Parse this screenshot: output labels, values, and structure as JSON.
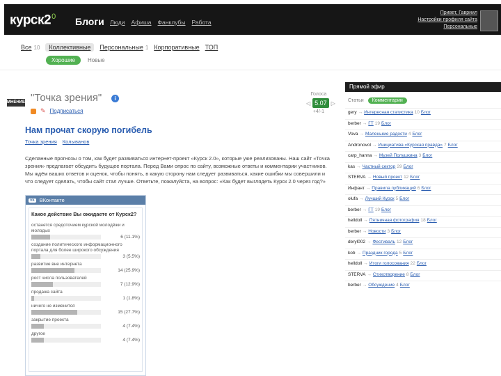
{
  "header": {
    "logo_text": "курск2",
    "logo_sup": "0",
    "section_title": "Блоги",
    "nav": [
      "Люди",
      "Афиша",
      "Фанклубы",
      "Работа"
    ],
    "user": {
      "line1": "Привет, Гавриил",
      "line2": "Настройки профиля сайта",
      "line3": "Персональные"
    }
  },
  "subnav": {
    "tabs": [
      {
        "label": "Все",
        "count": "10"
      },
      {
        "label": "Коллективные",
        "count": ""
      },
      {
        "label": "Персональные",
        "count": "1"
      },
      {
        "label": "Корпоративные",
        "count": ""
      },
      {
        "label": "ТОП",
        "count": ""
      }
    ],
    "pill_active": "Хорошие",
    "pill_other": "Новые"
  },
  "blog": {
    "logo_text": "МНЕНИЕ",
    "name": "\"Точка зрения\"",
    "info_icon": "i",
    "subscribe": "Подписаться"
  },
  "rating": {
    "label": "Голоса",
    "value": "5.07",
    "count": "+4/-1"
  },
  "post": {
    "title": "Нам прочат скорую погибель",
    "meta": [
      "Точка зрения",
      "Колыванов"
    ],
    "body": "Сделанные прогнозы о том, как будет развиваться интернет-проект «Курск 2.0», которые уже реализованы. Наш сайт «Точка зрения» предлагает обсудить будущее портала. Перед Вами опрос по сайту, возможные ответы и комментарии участников. Мы ждём ваших ответов и оценок, чтобы понять, в какую сторону нам следует развиваться, какие ошибки мы совершили и что следует сделать, чтобы сайт стал лучше. Ответьте, пожалуйста, на вопрос: «Как будет выглядеть Курск 2.0 через год?»"
  },
  "poll": {
    "brand": "ВКонтакте",
    "vk_icon": "vk",
    "question": "Какое действие Вы ожидаете от Курск2?",
    "options": [
      {
        "label": "останется средоточием курской молодёжи и молодых",
        "pct": "6 (11.1%)",
        "share": 0.111
      },
      {
        "label": "создание политического информационного портала для более широкого обсуждения",
        "pct": "3 (5.5%)",
        "share": 0.055
      },
      {
        "label": "развитие вне интернета",
        "pct": "14 (25.9%)",
        "share": 0.259
      },
      {
        "label": "рост числа пользователей",
        "pct": "7 (12.9%)",
        "share": 0.129
      },
      {
        "label": "продажа сайта",
        "pct": "1 (1.8%)",
        "share": 0.018
      },
      {
        "label": "ничего не изменится",
        "pct": "15 (27.7%)",
        "share": 0.277
      },
      {
        "label": "закрытие проекта",
        "pct": "4 (7.4%)",
        "share": 0.074
      },
      {
        "label": "другое",
        "pct": "4 (7.4%)",
        "share": 0.074
      }
    ]
  },
  "sidebar": {
    "title": "Прямой эфир",
    "tab_other": "Статьи",
    "tab_active": "Комментарии",
    "items": [
      {
        "author": "gery",
        "post": "Интересная статистика",
        "count": "10",
        "blog": "Блог"
      },
      {
        "author": "berber",
        "post": "ГТ",
        "count": "19",
        "blog": "Блог"
      },
      {
        "author": "Vova",
        "post": "Маленькие радости",
        "count": "4",
        "blog": "Блог"
      },
      {
        "author": "Andronovol",
        "post": "Инициатива «Курская правда»",
        "count": "7",
        "blog": "Блог"
      },
      {
        "author": "carp_hanna",
        "post": "Музей Полушкина",
        "count": "3",
        "blog": "Блог"
      },
      {
        "author": "kas",
        "post": "Частный сектор",
        "count": "29",
        "blog": "Блог"
      },
      {
        "author": "STERVA",
        "post": "Новый проект",
        "count": "12",
        "blog": "Блог"
      },
      {
        "author": "Инфант",
        "post": "Правила публикаций",
        "count": "6",
        "blog": "Блог"
      },
      {
        "author": "olufa",
        "post": "Лучший Курск",
        "count": "5",
        "blog": "Блог"
      },
      {
        "author": "berber",
        "post": "ГТ",
        "count": "19",
        "blog": "Блог"
      },
      {
        "author": "helldoll",
        "post": "Пятничная фотография",
        "count": "18",
        "blog": "Блог"
      },
      {
        "author": "berber",
        "post": "Новости",
        "count": "3",
        "blog": "Блог"
      },
      {
        "author": "deryl002",
        "post": "Фестиваль",
        "count": "12",
        "blog": "Блог"
      },
      {
        "author": "kob",
        "post": "Праздник города",
        "count": "5",
        "blog": "Блог"
      },
      {
        "author": "helldoll",
        "post": "Итоги голосования",
        "count": "22",
        "blog": "Блог"
      },
      {
        "author": "STERVA",
        "post": "Стихотворение",
        "count": "8",
        "blog": "Блог"
      },
      {
        "author": "berber",
        "post": "Обсуждение",
        "count": "4",
        "blog": "Блог"
      }
    ]
  }
}
